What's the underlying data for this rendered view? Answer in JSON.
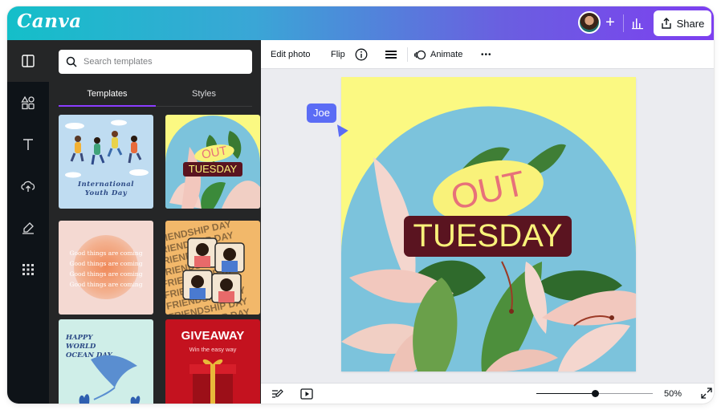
{
  "app": {
    "logo": "Canva"
  },
  "header": {
    "share_label": "Share",
    "add_collaborator": "+"
  },
  "search": {
    "placeholder": "Search templates"
  },
  "panel": {
    "tabs": [
      {
        "label": "Templates"
      },
      {
        "label": "Styles"
      }
    ],
    "templates": [
      {
        "text": "International Youth Day"
      },
      {
        "text_top": "OUT",
        "text_bottom": "TUESDAY"
      },
      {
        "lines": [
          "Good things are coming",
          "Good things are coming",
          "Good things are coming",
          "Good things are coming"
        ]
      },
      {
        "text": "FRIENDSHIP DAY"
      },
      {
        "text": "HAPPY WORLD OCEAN DAY"
      },
      {
        "title": "GIVEAWAY",
        "subtitle": "Win the easy way"
      }
    ]
  },
  "toolbar": {
    "edit_photo": "Edit photo",
    "flip": "Flip",
    "animate": "Animate",
    "more": "•••"
  },
  "design": {
    "out": "OUT",
    "tuesday": "TUESDAY"
  },
  "collaborator": {
    "name": "Joe"
  },
  "footer": {
    "zoom": "50%",
    "zoom_level": 0.5
  },
  "colors": {
    "accent": "#8b3dff",
    "collab": "#5b6cf5",
    "canvas_bg": "#fbf982",
    "sky": "#7cc3dc",
    "tuesday_bg": "#5a1420",
    "out_bubble": "#f9f27a",
    "out_text": "#e7717a"
  }
}
